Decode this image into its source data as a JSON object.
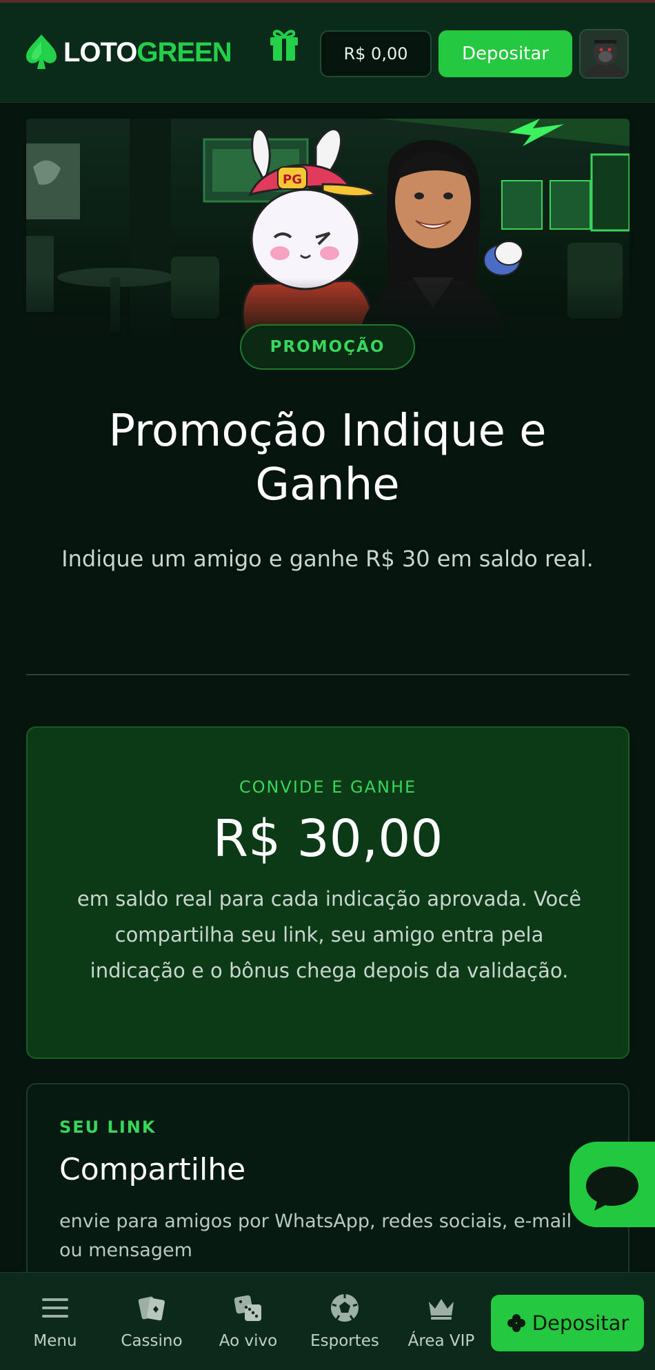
{
  "header": {
    "logo_white": "LOTO",
    "logo_green": "GREEN",
    "balance": "R$ 0,00",
    "deposit_label": "Depositar"
  },
  "hero": {
    "badge": "PROMOÇÃO",
    "title": "Promoção Indique e Ganhe",
    "subtitle": "Indique um amigo e ganhe R$ 30 em saldo real.",
    "cap_text": "PG"
  },
  "invite_card": {
    "eyebrow": "CONVIDE E GANHE",
    "amount": "R$ 30,00",
    "description": "em saldo real para cada indicação aprovada. Você compartilha seu link, seu amigo entra pela indicação e o bônus chega depois da validação."
  },
  "link_card": {
    "eyebrow": "SEU LINK",
    "title": "Compartilhe",
    "description": "envie para amigos por WhatsApp, redes sociais, e-mail ou mensagem"
  },
  "bottom_nav": {
    "items": [
      {
        "label": "Menu",
        "icon": "menu-icon"
      },
      {
        "label": "Cassino",
        "icon": "cards-icon"
      },
      {
        "label": "Ao vivo",
        "icon": "dice-icon"
      },
      {
        "label": "Esportes",
        "icon": "soccer-ball-icon"
      },
      {
        "label": "Área VIP",
        "icon": "crown-icon"
      }
    ],
    "deposit_label": "Depositar"
  },
  "colors": {
    "accent": "#25c93f",
    "background": "#06140e",
    "header": "#0a2a1a",
    "card_green": "#0c3a17"
  }
}
